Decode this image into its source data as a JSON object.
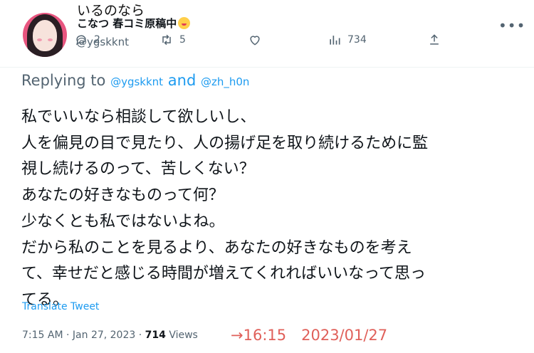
{
  "previous_tweet": {
    "text_tail": "いるのなら",
    "author_name": "こなつ 春コミ原稿中",
    "author_handle": "@ygskknt",
    "reply_count": "2",
    "retweet_count": "5",
    "view_count": "734",
    "icons": [
      "reply-icon",
      "retweet-icon",
      "like-icon",
      "views-icon",
      "share-icon",
      "more-icon"
    ]
  },
  "tweet": {
    "replying_label": "Replying to",
    "replying_to": [
      "@ygskknt",
      "@zh_h0n"
    ],
    "and_word": "and",
    "lines": [
      "私でいいなら相談して欲しいし、",
      "人を偏見の目で見たり、人の揚げ足を取り続けるために監",
      "視し続けるのって、苦しくない？",
      "あなたの好きなものって何？",
      "少なくとも私ではないよね。",
      "だから私のことを見るより、あなたの好きなものを考え",
      "て、幸せだと感じる時間が増えてくれればいいなって思っ",
      "てる。"
    ],
    "translate_label": "Translate Tweet",
    "time": "7:15 AM",
    "separator": "·",
    "date": "Jan 27, 2023",
    "views_count": "714",
    "views_label": "Views"
  },
  "annotation": "→16:15　2023/01/27",
  "colors": {
    "link": "#1d9bf0",
    "muted": "#536471",
    "text": "#0f1419",
    "annotation": "#e0605a",
    "avatar_bg": "#e8557f"
  }
}
